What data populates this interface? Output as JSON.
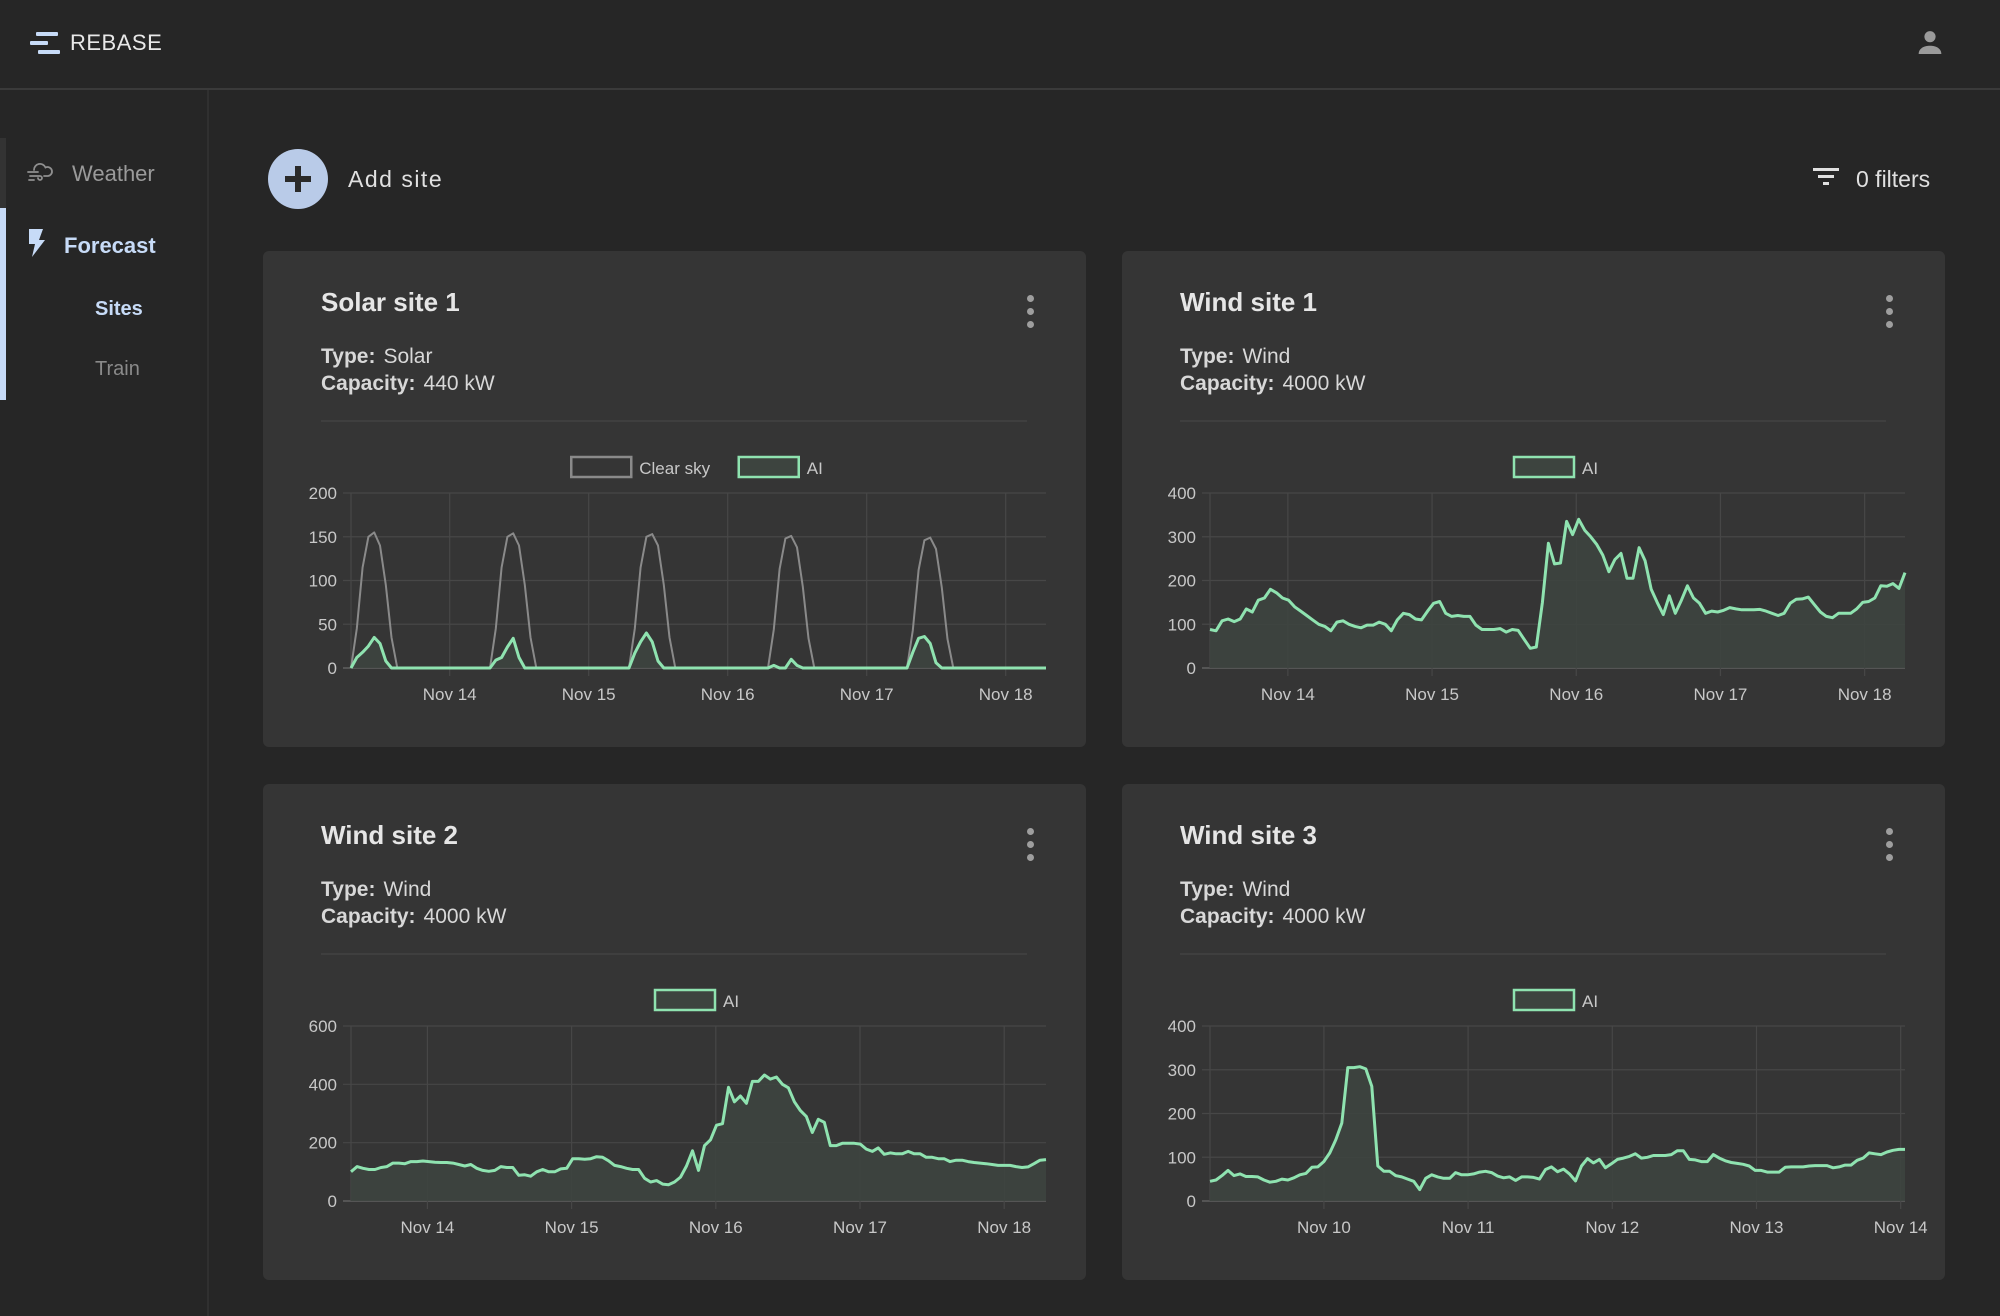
{
  "header": {
    "brand": "REBASE",
    "icons": {
      "logo": "rebase-logo-icon",
      "user": "account-icon"
    }
  },
  "sidebar": {
    "items": [
      {
        "label": "Weather",
        "icon": "weather-wind-cloud-icon",
        "active": false
      },
      {
        "label": "Forecast",
        "icon": "lightning-bolt-icon",
        "active": true,
        "children": [
          {
            "label": "Sites",
            "active": true
          },
          {
            "label": "Train",
            "active": false
          }
        ]
      }
    ]
  },
  "toolbar": {
    "add_site_label": "Add site",
    "add_site_icon": "plus-circle-icon",
    "filters_label": "0 filters",
    "filters_icon": "filter-list-icon"
  },
  "colors": {
    "accent": "#c7dbf7",
    "ai_line": "#8fe3b0",
    "ai_fill": "#3d443f",
    "clear_sky_line": "#8a8a8a",
    "card_bg": "#353535",
    "page_bg": "#262626"
  },
  "labels": {
    "type": "Type:",
    "capacity": "Capacity:"
  },
  "sites": [
    {
      "title": "Solar site 1",
      "type": "Solar",
      "capacity": "440 kW"
    },
    {
      "title": "Wind site 1",
      "type": "Wind",
      "capacity": "4000 kW"
    },
    {
      "title": "Wind site 2",
      "type": "Wind",
      "capacity": "4000 kW"
    },
    {
      "title": "Wind site 3",
      "type": "Wind",
      "capacity": "4000 kW"
    }
  ],
  "chart_data": [
    {
      "type": "area",
      "title": "Solar site 1",
      "xlabel": "",
      "ylabel": "",
      "ylim": [
        0,
        200
      ],
      "yticks": [
        0,
        50,
        100,
        150,
        200
      ],
      "x_start_day_offset": -0.71,
      "x_end_day_offset": 4.29,
      "xticks": [
        "Nov 14",
        "Nov 15",
        "Nov 16",
        "Nov 17",
        "Nov 18"
      ],
      "interval_hours": 1,
      "grid": true,
      "legend": "top-center",
      "series": [
        {
          "name": "Clear sky",
          "color": "#8a8a8a",
          "fill": false,
          "values": [
            0,
            45,
            115,
            150,
            155,
            140,
            95,
            35,
            0,
            0,
            0,
            0,
            0,
            0,
            0,
            0,
            0,
            0,
            0,
            0,
            0,
            0,
            0,
            0,
            0,
            45,
            115,
            150,
            154,
            140,
            95,
            35,
            0,
            0,
            0,
            0,
            0,
            0,
            0,
            0,
            0,
            0,
            0,
            0,
            0,
            0,
            0,
            0,
            0,
            45,
            115,
            150,
            153,
            140,
            95,
            35,
            0,
            0,
            0,
            0,
            0,
            0,
            0,
            0,
            0,
            0,
            0,
            0,
            0,
            0,
            0,
            0,
            0,
            44,
            113,
            148,
            151,
            138,
            93,
            34,
            0,
            0,
            0,
            0,
            0,
            0,
            0,
            0,
            0,
            0,
            0,
            0,
            0,
            0,
            0,
            0,
            0,
            43,
            112,
            146,
            149,
            136,
            92,
            33,
            0,
            0,
            0,
            0,
            0,
            0,
            0,
            0,
            0,
            0,
            0,
            0,
            0,
            0,
            0,
            0,
            0
          ]
        },
        {
          "name": "AI",
          "color": "#8fe3b0",
          "fill": true,
          "values": [
            0,
            12,
            18,
            25,
            35,
            28,
            8,
            0,
            0,
            0,
            0,
            0,
            0,
            0,
            0,
            0,
            0,
            0,
            0,
            0,
            0,
            0,
            0,
            0,
            0,
            9,
            12,
            24,
            34,
            12,
            0,
            0,
            0,
            0,
            0,
            0,
            0,
            0,
            0,
            0,
            0,
            0,
            0,
            0,
            0,
            0,
            0,
            0,
            0,
            17,
            30,
            40,
            30,
            8,
            0,
            0,
            0,
            0,
            0,
            0,
            0,
            0,
            0,
            0,
            0,
            0,
            0,
            0,
            0,
            0,
            0,
            0,
            0,
            3,
            0,
            0,
            10,
            3,
            0,
            0,
            0,
            0,
            0,
            0,
            0,
            0,
            0,
            0,
            0,
            0,
            0,
            0,
            0,
            0,
            0,
            0,
            0,
            18,
            34,
            36,
            28,
            6,
            0,
            0,
            0,
            0,
            0,
            0,
            0,
            0,
            0,
            0,
            0,
            0,
            0,
            0,
            0,
            0,
            0,
            0,
            0
          ]
        }
      ]
    },
    {
      "type": "area",
      "title": "Wind site 1",
      "ylim": [
        0,
        400
      ],
      "yticks": [
        0,
        100,
        200,
        300,
        400
      ],
      "x_start_day_offset": -0.54,
      "x_end_day_offset": 4.28,
      "xticks": [
        "Nov 14",
        "Nov 15",
        "Nov 16",
        "Nov 17",
        "Nov 18"
      ],
      "interval_hours": 1,
      "grid": true,
      "legend": "top-center",
      "series": [
        {
          "name": "AI",
          "color": "#8fe3b0",
          "fill": true,
          "values": [
            88,
            85,
            108,
            112,
            106,
            112,
            135,
            128,
            155,
            160,
            180,
            172,
            160,
            155,
            140,
            130,
            120,
            110,
            100,
            95,
            85,
            105,
            108,
            100,
            95,
            92,
            98,
            98,
            105,
            100,
            85,
            110,
            125,
            122,
            112,
            110,
            130,
            148,
            152,
            125,
            118,
            120,
            118,
            118,
            98,
            88,
            88,
            88,
            90,
            82,
            88,
            86,
            65,
            45,
            48,
            150,
            285,
            238,
            240,
            335,
            305,
            340,
            315,
            300,
            282,
            258,
            220,
            248,
            262,
            205,
            205,
            275,
            245,
            180,
            150,
            122,
            165,
            125,
            155,
            188,
            160,
            148,
            125,
            130,
            128,
            132,
            138,
            135,
            133,
            133,
            133,
            134,
            130,
            125,
            120,
            125,
            148,
            157,
            158,
            162,
            145,
            128,
            118,
            115,
            125,
            125,
            125,
            135,
            150,
            152,
            160,
            188,
            187,
            193,
            182,
            218
          ]
        }
      ]
    },
    {
      "type": "area",
      "title": "Wind site 2",
      "ylim": [
        0,
        600
      ],
      "yticks": [
        0,
        200,
        400,
        600
      ],
      "x_start_day_offset": -0.53,
      "x_end_day_offset": 4.29,
      "xticks": [
        "Nov 14",
        "Nov 15",
        "Nov 16",
        "Nov 17",
        "Nov 18"
      ],
      "interval_hours": 1,
      "grid": true,
      "legend": "top-center",
      "series": [
        {
          "name": "AI",
          "color": "#8fe3b0",
          "fill": true,
          "values": [
            100,
            118,
            112,
            108,
            108,
            115,
            118,
            130,
            130,
            128,
            135,
            135,
            137,
            135,
            133,
            132,
            132,
            130,
            125,
            120,
            125,
            112,
            105,
            102,
            105,
            118,
            115,
            115,
            88,
            90,
            85,
            100,
            108,
            100,
            100,
            110,
            112,
            145,
            145,
            143,
            145,
            152,
            150,
            138,
            122,
            118,
            112,
            108,
            108,
            78,
            65,
            70,
            58,
            56,
            65,
            82,
            120,
            172,
            105,
            190,
            210,
            260,
            265,
            390,
            340,
            360,
            335,
            410,
            410,
            432,
            418,
            425,
            400,
            388,
            340,
            310,
            290,
            235,
            280,
            270,
            190,
            190,
            198,
            198,
            198,
            195,
            178,
            170,
            182,
            160,
            165,
            162,
            162,
            170,
            162,
            162,
            150,
            150,
            145,
            145,
            135,
            140,
            140,
            135,
            132,
            130,
            128,
            125,
            122,
            122,
            122,
            118,
            115,
            117,
            128,
            140,
            142
          ]
        }
      ]
    },
    {
      "type": "area",
      "title": "Wind site 3",
      "ylim": [
        0,
        400
      ],
      "yticks": [
        0,
        100,
        200,
        300,
        400
      ],
      "x_start_day_offset": -0.79,
      "x_end_day_offset": 4.03,
      "xticks": [
        "Nov 10",
        "Nov 11",
        "Nov 12",
        "Nov 13",
        "Nov 14"
      ],
      "interval_hours": 1,
      "grid": true,
      "legend": "top-center",
      "series": [
        {
          "name": "AI",
          "color": "#8fe3b0",
          "fill": true,
          "values": [
            45,
            48,
            58,
            70,
            58,
            62,
            56,
            56,
            55,
            48,
            43,
            45,
            50,
            48,
            53,
            60,
            63,
            77,
            78,
            90,
            110,
            140,
            178,
            305,
            305,
            307,
            302,
            262,
            80,
            68,
            68,
            58,
            55,
            50,
            45,
            26,
            52,
            60,
            55,
            52,
            52,
            65,
            60,
            60,
            62,
            66,
            68,
            65,
            57,
            53,
            55,
            47,
            55,
            55,
            54,
            50,
            72,
            78,
            67,
            73,
            62,
            46,
            80,
            97,
            87,
            95,
            76,
            85,
            95,
            98,
            102,
            108,
            98,
            100,
            104,
            104,
            104,
            106,
            115,
            115,
            95,
            94,
            90,
            90,
            106,
            98,
            92,
            88,
            86,
            84,
            80,
            70,
            70,
            66,
            66,
            66,
            77,
            78,
            78,
            78,
            80,
            81,
            81,
            81,
            76,
            78,
            82,
            82,
            93,
            98,
            110,
            108,
            106,
            112,
            116,
            118,
            118
          ]
        }
      ]
    }
  ]
}
